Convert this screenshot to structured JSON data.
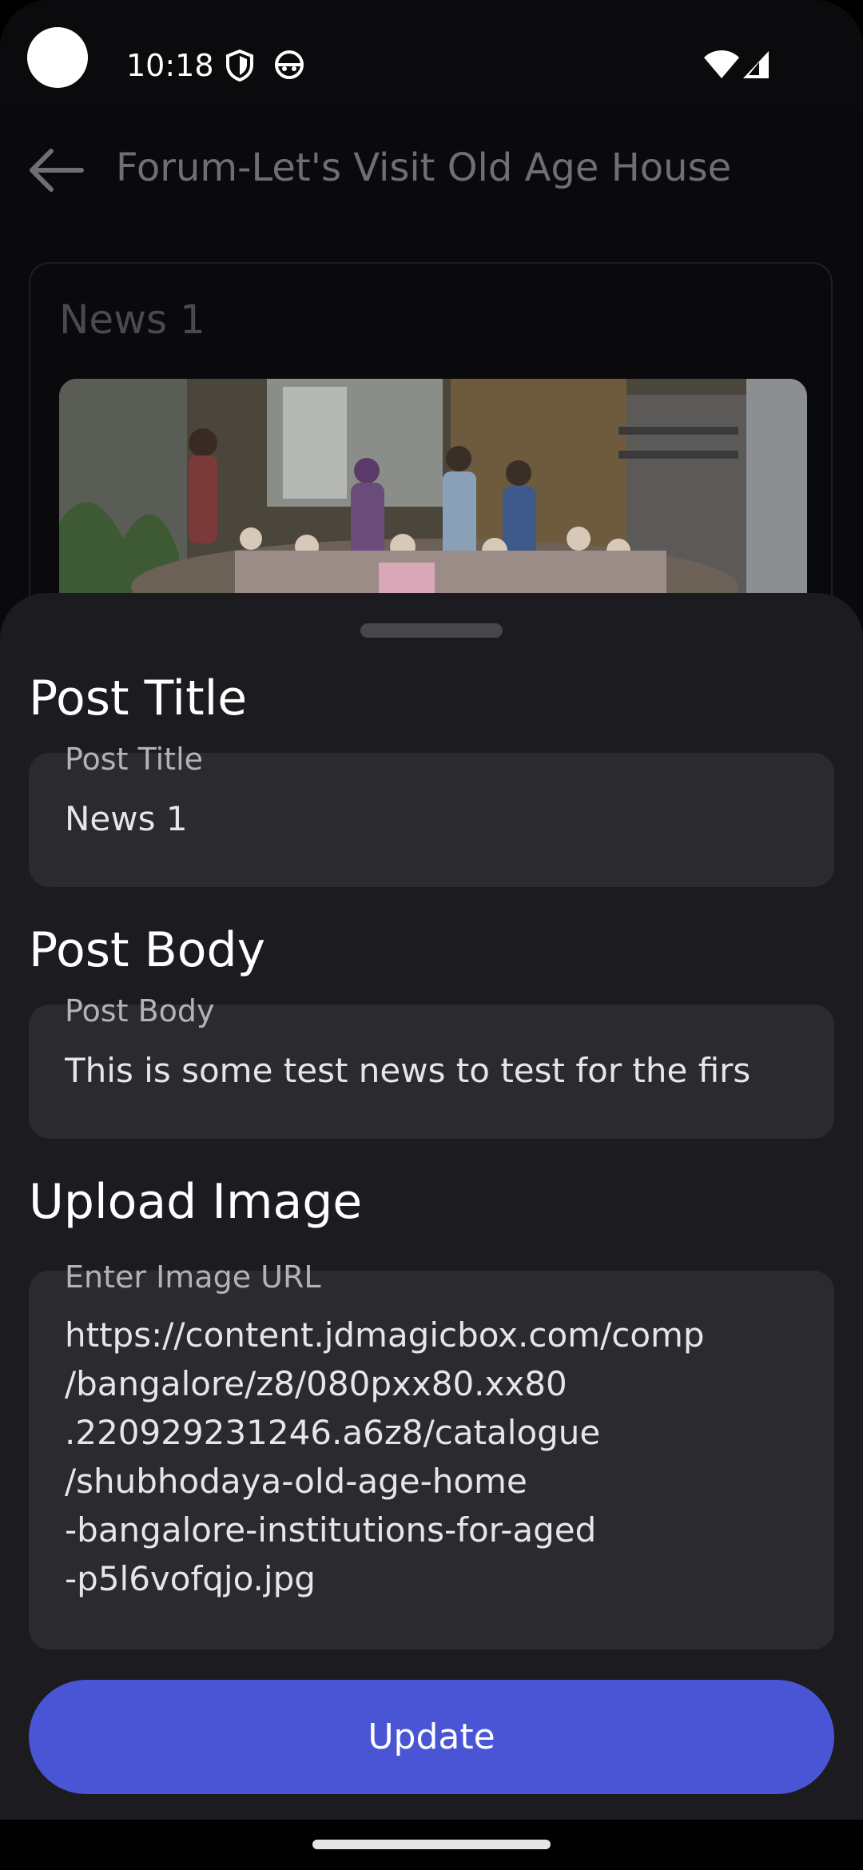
{
  "status_bar": {
    "time": "10:18",
    "icons": [
      "shield-icon",
      "android-face-icon",
      "wifi-icon",
      "signal-icon"
    ]
  },
  "app_bar": {
    "title": "Forum-Let's Visit Old Age House",
    "back_icon": "arrow-back-icon"
  },
  "background_card": {
    "title": "News 1"
  },
  "sheet": {
    "post_title_heading": "Post Title",
    "post_title_label": "Post Title",
    "post_title_value": "News 1",
    "post_body_heading": "Post Body",
    "post_body_label": "Post Body",
    "post_body_value": "This is some test news to test for the firs",
    "upload_image_heading": "Upload Image",
    "image_url_label": "Enter Image URL",
    "image_url_value": "https://content.jdmagicbox.com/comp\n/bangalore/z8/080pxx80.xx80\n.220929231246.a6z8/catalogue\n/shubhodaya-old-age-home\n-bangalore-institutions-for-aged\n-p5l6vofqjo.jpg",
    "update_label": "Update"
  },
  "colors": {
    "accent": "#4a55d6",
    "sheet_bg": "#1c1b1f",
    "field_bg": "#2b2a2e"
  }
}
